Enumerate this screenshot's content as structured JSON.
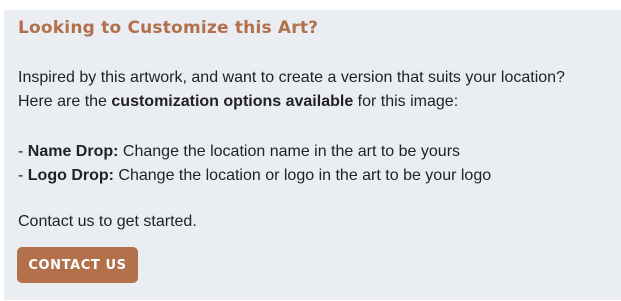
{
  "colors": {
    "accent": "#b2704b",
    "panel_bg": "#eaeef3",
    "text": "#222222"
  },
  "panel": {
    "heading": "Looking to Customize this Art?",
    "intro": {
      "line1": "Inspired by this artwork, and want to create a version that suits your location?",
      "line2_before": "Here are the ",
      "line2_bold": "customization options available",
      "line2_after": " for this image:"
    },
    "options": [
      {
        "prefix": "- ",
        "title": "Name Drop:",
        "description": " Change the location name in the art to be yours"
      },
      {
        "prefix": "- ",
        "title": "Logo Drop:",
        "description": " Change the location or logo in the art to be your logo"
      }
    ],
    "contact_text": "Contact us to get started.",
    "cta_label": "CONTACT US"
  }
}
